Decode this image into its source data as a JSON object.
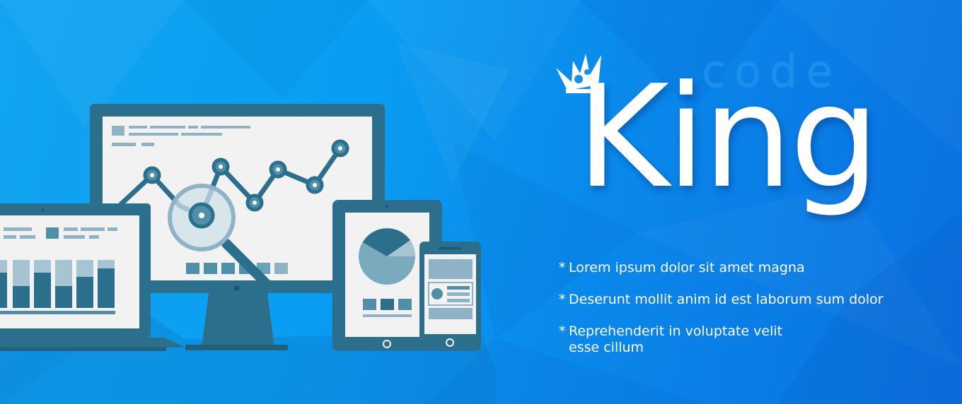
{
  "brand": {
    "top_word": "code",
    "main_word": "King",
    "crown": "crown-icon"
  },
  "features": [
    {
      "bullet": "*",
      "text": "Lorem ipsum dolor sit amet magna"
    },
    {
      "bullet": "*",
      "text": "Deserunt mollit anim id est laborum sum dolor"
    },
    {
      "bullet": "*",
      "text": "Reprehenderit in voluptate velit esse cillum"
    }
  ],
  "illustration": {
    "icons": [
      "desktop-monitor-icon",
      "laptop-icon",
      "tablet-icon",
      "smartphone-icon",
      "magnifier-icon",
      "line-chart-icon",
      "bar-chart-icon",
      "pie-chart-icon"
    ]
  },
  "colors": {
    "background": "#0a9ef2",
    "device_dark": "#2c6f8c",
    "device_screen": "#f2f2f2",
    "chart_mark": "#4f8fa8",
    "code_text": "#1a8fec",
    "king_text": "#ffffff"
  }
}
